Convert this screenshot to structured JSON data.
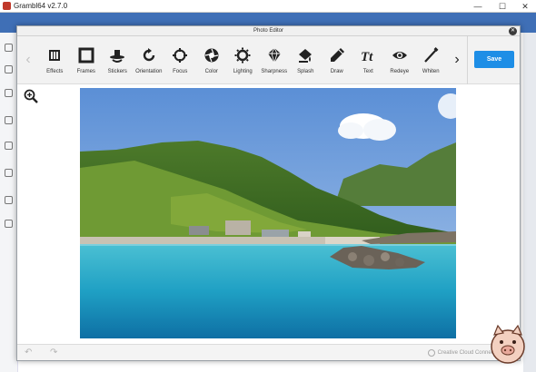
{
  "window": {
    "title": "Grambl64 v2.7.0",
    "minimize": "—",
    "maximize": "☐",
    "close": "✕"
  },
  "modal": {
    "title": "Photo Editor",
    "close": "✕"
  },
  "tools": [
    {
      "label": "Effects",
      "icon": "effects-icon"
    },
    {
      "label": "Frames",
      "icon": "frames-icon"
    },
    {
      "label": "Stickers",
      "icon": "stickers-icon"
    },
    {
      "label": "Orientation",
      "icon": "orientation-icon"
    },
    {
      "label": "Focus",
      "icon": "focus-icon"
    },
    {
      "label": "Color",
      "icon": "color-icon"
    },
    {
      "label": "Lighting",
      "icon": "lighting-icon"
    },
    {
      "label": "Sharpness",
      "icon": "sharpness-icon"
    },
    {
      "label": "Splash",
      "icon": "splash-icon"
    },
    {
      "label": "Draw",
      "icon": "draw-icon"
    },
    {
      "label": "Text",
      "icon": "text-icon"
    },
    {
      "label": "Redeye",
      "icon": "redeye-icon"
    },
    {
      "label": "Whiten",
      "icon": "whiten-icon"
    }
  ],
  "toolbar": {
    "prev": "‹",
    "next": "›",
    "save_label": "Save"
  },
  "footer": {
    "undo": "↶",
    "redo": "↷",
    "brand": "Creative Cloud Connected"
  },
  "colors": {
    "accent": "#1e8ee6",
    "header": "#3f6fb6"
  }
}
